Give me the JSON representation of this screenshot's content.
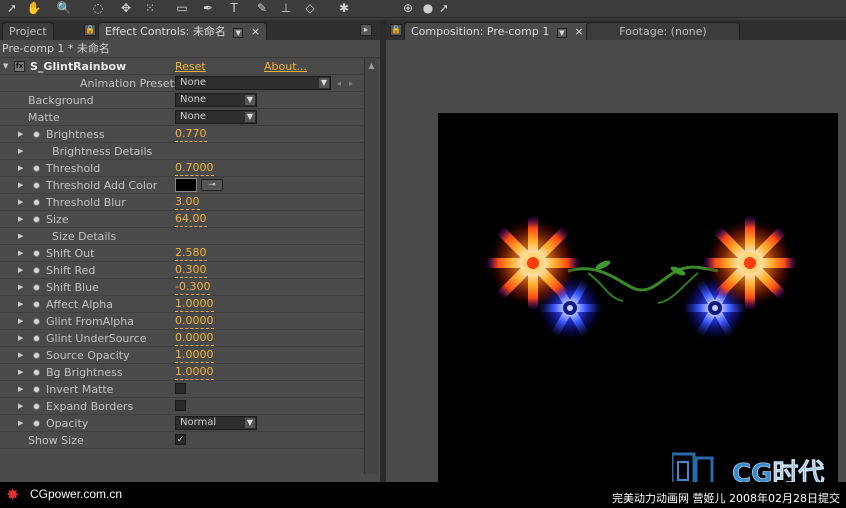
{
  "effect_controls": {
    "tab_project": "Project",
    "tab_effect": "Effect Controls: 未命名",
    "breadcrumb": "Pre-comp 1 * 未命名",
    "effect_name": "S_GlintRainbow",
    "reset": "Reset",
    "about": "About...",
    "presets_label": "Animation Presets:",
    "presets_value": "None",
    "rows": [
      {
        "label": "Background",
        "type": "dropdown",
        "value": "None",
        "indent": "plain"
      },
      {
        "label": "Matte",
        "type": "dropdown",
        "value": "None",
        "indent": "plain"
      },
      {
        "label": "Brightness",
        "type": "value",
        "value": "0.770"
      },
      {
        "label": "Brightness Details",
        "type": "group"
      },
      {
        "label": "Threshold",
        "type": "value",
        "value": "0.7000"
      },
      {
        "label": "Threshold Add Color",
        "type": "color"
      },
      {
        "label": "Threshold Blur",
        "type": "value",
        "value": "3.00"
      },
      {
        "label": "Size",
        "type": "value",
        "value": "64.00"
      },
      {
        "label": "Size Details",
        "type": "group"
      },
      {
        "label": "Shift Out",
        "type": "value",
        "value": "2.580"
      },
      {
        "label": "Shift Red",
        "type": "value",
        "value": "0.300"
      },
      {
        "label": "Shift Blue",
        "type": "value",
        "value": "-0.300"
      },
      {
        "label": "Affect Alpha",
        "type": "value",
        "value": "1.0000"
      },
      {
        "label": "Glint FromAlpha",
        "type": "value",
        "value": "0.0000"
      },
      {
        "label": "Glint UnderSource",
        "type": "value",
        "value": "0.0000"
      },
      {
        "label": "Source Opacity",
        "type": "value",
        "value": "1.0000"
      },
      {
        "label": "Bg Brightness",
        "type": "value",
        "value": "1.0000"
      },
      {
        "label": "Invert Matte",
        "type": "checkbox",
        "checked": false
      },
      {
        "label": "Expand Borders",
        "type": "checkbox",
        "checked": false
      },
      {
        "label": "Opacity",
        "type": "dropdown",
        "value": "Normal"
      },
      {
        "label": "Show Size",
        "type": "checkbox",
        "checked": true,
        "indent": "plain"
      }
    ]
  },
  "composition": {
    "tab_composition": "Composition: Pre-comp 1",
    "tab_footage": "Footage: (none)"
  },
  "watermark": {
    "site": "CGpower.com.cn",
    "credit": "完美动力动画网 营姬儿 2008年02月28日提交",
    "logo_text": "CG时代"
  },
  "colors": {
    "accent": "#f0b43c",
    "panel": "#4a4a4a"
  }
}
